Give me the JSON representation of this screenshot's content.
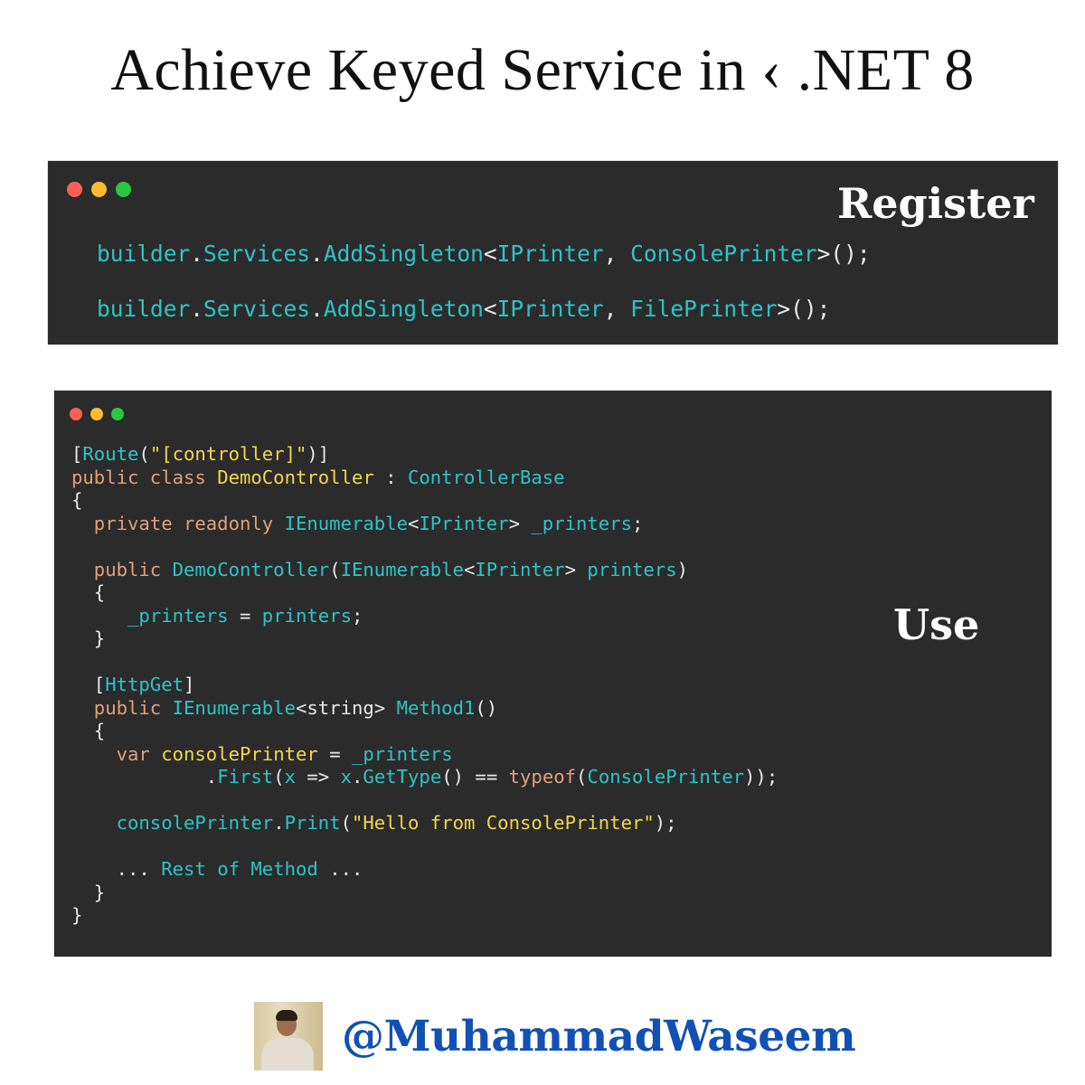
{
  "title": "Achieve Keyed Service in ‹ .NET 8",
  "register_panel": {
    "label": "Register",
    "lines": [
      [
        {
          "t": "builder",
          "c": "cyan"
        },
        {
          "t": ".",
          "c": "white"
        },
        {
          "t": "Services",
          "c": "cyan"
        },
        {
          "t": ".",
          "c": "white"
        },
        {
          "t": "AddSingleton",
          "c": "cyan"
        },
        {
          "t": "<",
          "c": "white"
        },
        {
          "t": "IPrinter",
          "c": "cyan"
        },
        {
          "t": ", ",
          "c": "white"
        },
        {
          "t": "ConsolePrinter",
          "c": "cyan"
        },
        {
          "t": ">();",
          "c": "white"
        }
      ],
      [
        {
          "t": "builder",
          "c": "cyan"
        },
        {
          "t": ".",
          "c": "white"
        },
        {
          "t": "Services",
          "c": "cyan"
        },
        {
          "t": ".",
          "c": "white"
        },
        {
          "t": "AddSingleton",
          "c": "cyan"
        },
        {
          "t": "<",
          "c": "white"
        },
        {
          "t": "IPrinter",
          "c": "cyan"
        },
        {
          "t": ", ",
          "c": "white"
        },
        {
          "t": "FilePrinter",
          "c": "cyan"
        },
        {
          "t": ">();",
          "c": "white"
        }
      ]
    ]
  },
  "use_panel": {
    "label": "Use",
    "lines": [
      [
        {
          "t": "[",
          "c": "white"
        },
        {
          "t": "Route",
          "c": "cyan"
        },
        {
          "t": "(",
          "c": "white"
        },
        {
          "t": "\"[controller]\"",
          "c": "yellow"
        },
        {
          "t": ")]",
          "c": "white"
        }
      ],
      [
        {
          "t": "public class ",
          "c": "kw"
        },
        {
          "t": "DemoController",
          "c": "yellow"
        },
        {
          "t": " : ",
          "c": "white"
        },
        {
          "t": "ControllerBase",
          "c": "cyan"
        }
      ],
      [
        {
          "t": "{",
          "c": "white"
        }
      ],
      [
        {
          "t": "  private readonly ",
          "c": "kw"
        },
        {
          "t": "IEnumerable",
          "c": "cyan"
        },
        {
          "t": "<",
          "c": "white"
        },
        {
          "t": "IPrinter",
          "c": "cyan"
        },
        {
          "t": "> ",
          "c": "white"
        },
        {
          "t": "_printers",
          "c": "cyan"
        },
        {
          "t": ";",
          "c": "white"
        }
      ],
      [],
      [
        {
          "t": "  public ",
          "c": "kw"
        },
        {
          "t": "DemoController",
          "c": "cyan"
        },
        {
          "t": "(",
          "c": "white"
        },
        {
          "t": "IEnumerable",
          "c": "cyan"
        },
        {
          "t": "<",
          "c": "white"
        },
        {
          "t": "IPrinter",
          "c": "cyan"
        },
        {
          "t": "> ",
          "c": "white"
        },
        {
          "t": "printers",
          "c": "cyan"
        },
        {
          "t": ")",
          "c": "white"
        }
      ],
      [
        {
          "t": "  {",
          "c": "white"
        }
      ],
      [
        {
          "t": "     _printers",
          "c": "cyan"
        },
        {
          "t": " = ",
          "c": "white"
        },
        {
          "t": "printers",
          "c": "cyan"
        },
        {
          "t": ";",
          "c": "white"
        }
      ],
      [
        {
          "t": "  }",
          "c": "white"
        }
      ],
      [],
      [
        {
          "t": "  [",
          "c": "white"
        },
        {
          "t": "HttpGet",
          "c": "cyan"
        },
        {
          "t": "]",
          "c": "white"
        }
      ],
      [
        {
          "t": "  public ",
          "c": "kw"
        },
        {
          "t": "IEnumerable",
          "c": "cyan"
        },
        {
          "t": "<string> ",
          "c": "white"
        },
        {
          "t": "Method1",
          "c": "cyan"
        },
        {
          "t": "()",
          "c": "white"
        }
      ],
      [
        {
          "t": "  {",
          "c": "white"
        }
      ],
      [
        {
          "t": "    var ",
          "c": "kw"
        },
        {
          "t": "consolePrinter",
          "c": "yellow"
        },
        {
          "t": " = ",
          "c": "white"
        },
        {
          "t": "_printers",
          "c": "cyan"
        }
      ],
      [
        {
          "t": "            .",
          "c": "white"
        },
        {
          "t": "First",
          "c": "cyan"
        },
        {
          "t": "(",
          "c": "white"
        },
        {
          "t": "x",
          "c": "cyan"
        },
        {
          "t": " => ",
          "c": "white"
        },
        {
          "t": "x",
          "c": "cyan"
        },
        {
          "t": ".",
          "c": "white"
        },
        {
          "t": "GetType",
          "c": "cyan"
        },
        {
          "t": "() == ",
          "c": "white"
        },
        {
          "t": "typeof",
          "c": "kw"
        },
        {
          "t": "(",
          "c": "white"
        },
        {
          "t": "ConsolePrinter",
          "c": "cyan"
        },
        {
          "t": "));",
          "c": "white"
        }
      ],
      [],
      [
        {
          "t": "    consolePrinter",
          "c": "cyan"
        },
        {
          "t": ".",
          "c": "white"
        },
        {
          "t": "Print",
          "c": "cyan"
        },
        {
          "t": "(",
          "c": "white"
        },
        {
          "t": "\"Hello from ConsolePrinter\"",
          "c": "yellow"
        },
        {
          "t": ");",
          "c": "white"
        }
      ],
      [],
      [
        {
          "t": "    ... ",
          "c": "white"
        },
        {
          "t": "Rest of Method",
          "c": "cyan"
        },
        {
          "t": " ...",
          "c": "white"
        }
      ],
      [
        {
          "t": "  }",
          "c": "white"
        }
      ],
      [
        {
          "t": "}",
          "c": "white"
        }
      ]
    ]
  },
  "footer": {
    "avatar_icon": "profile-photo",
    "handle": "@MuhammadWaseem"
  },
  "colors": {
    "panel_bg": "#2b2b2b",
    "token_cyan": "#2ec4c6",
    "token_keyword": "#e0a07a",
    "token_yellow": "#f0d84a",
    "handle_blue": "#1250b5"
  }
}
